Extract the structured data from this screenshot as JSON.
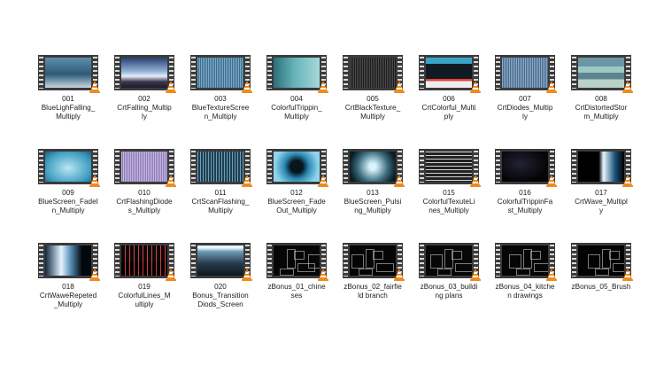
{
  "items": [
    {
      "label": "001\nBlueLighFalling_\nMultiply",
      "icon": "video-file-icon"
    },
    {
      "label": "002\nCrtFalling_Multip\nly",
      "icon": "video-file-icon"
    },
    {
      "label": "003\nBlueTextureScree\nn_Multiply",
      "icon": "video-file-icon"
    },
    {
      "label": "004\nColorfulTrippin_\nMultiply",
      "icon": "video-file-icon"
    },
    {
      "label": "005\nCrtBlackTexture_\nMultiply",
      "icon": "video-file-icon"
    },
    {
      "label": "006\nCrtColorful_Multi\nply",
      "icon": "video-file-icon"
    },
    {
      "label": "007\nCrtDiodes_Multip\nly",
      "icon": "video-file-icon"
    },
    {
      "label": "008\nCrtDistortedStor\nm_Multiply",
      "icon": "video-file-icon"
    },
    {
      "label": "009\nBlueScreen_FadeI\nn_Multiply",
      "icon": "video-file-icon"
    },
    {
      "label": "010\nCrtFlashingDiode\ns_Multiply",
      "icon": "video-file-icon"
    },
    {
      "label": "011\nCrtScanFlashing_\nMultiply",
      "icon": "video-file-icon"
    },
    {
      "label": "012\nBlueScreen_Fade\nOut_Multiply",
      "icon": "video-file-icon"
    },
    {
      "label": "013\nBlueScreen_Pulsi\nng_Multiply",
      "icon": "video-file-icon"
    },
    {
      "label": "015\nColorfulTexuteLi\nnes_Multiply",
      "icon": "video-file-icon"
    },
    {
      "label": "016\nColorfulTrippinFa\nst_Multiply",
      "icon": "video-file-icon"
    },
    {
      "label": "017\nCrtWave_Multipl\ny",
      "icon": "video-file-icon"
    },
    {
      "label": "018\nCrtWaweRepeted\n_Multiply",
      "icon": "video-file-icon"
    },
    {
      "label": "019\nColorfulLines_M\nultiply",
      "icon": "video-file-icon"
    },
    {
      "label": "020\nBonus_Transition\nDiods_Screen",
      "icon": "video-file-icon"
    },
    {
      "label": "zBonus_01_chine\nses",
      "icon": "video-file-icon"
    },
    {
      "label": "zBonus_02_fairfie\nld branch",
      "icon": "video-file-icon"
    },
    {
      "label": "zBonus_03_buildi\nng plans",
      "icon": "video-file-icon"
    },
    {
      "label": "zBonus_04_kitche\nn drawings",
      "icon": "video-file-icon"
    },
    {
      "label": "zBonus_05_Brush",
      "icon": "video-file-icon"
    }
  ],
  "colors": {
    "cone_orange": "#f08a1c",
    "cone_white": "#ffffff",
    "film": "#3b3b3b"
  }
}
